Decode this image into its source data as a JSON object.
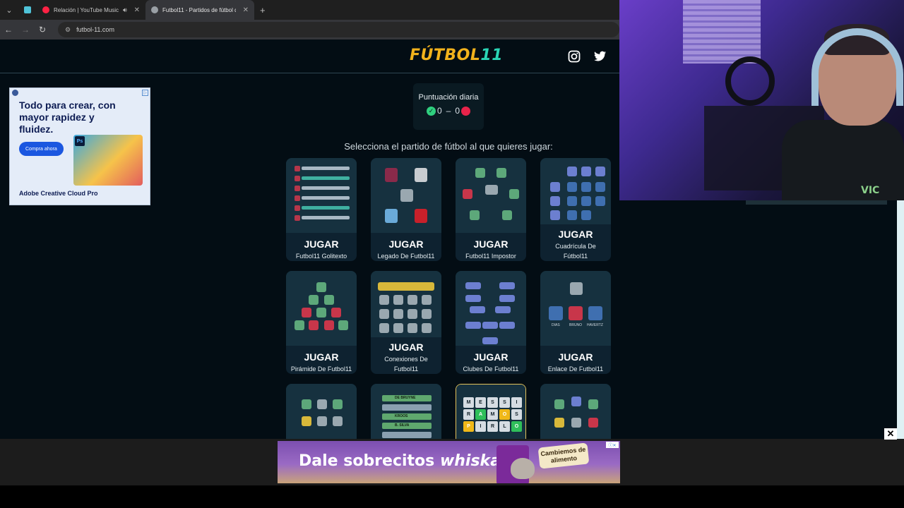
{
  "browser": {
    "tabs": [
      {
        "title": "Relación | YouTube Music",
        "favicon_color": "#ff2244"
      },
      {
        "title": "Futbol11 - Partidos de fútbol di",
        "favicon_color": "#9aa0a6"
      }
    ],
    "url": "futbol-11.com"
  },
  "site": {
    "logo_main": "FÚTBOL",
    "logo_num": "11",
    "daily_score": {
      "label": "Puntuación diaria",
      "wins": "0",
      "separator": "–",
      "losses": "0"
    },
    "prompt": "Selecciona el partido de fútbol al que quieres jugar:",
    "play_label": "JUGAR",
    "games": [
      {
        "name": "Futbol11 Golitexto"
      },
      {
        "name": "Legado De Futbol11"
      },
      {
        "name": "Futbol11 Impostor"
      },
      {
        "name": "Cuadrícula De Fútbol11"
      },
      {
        "name": "Pirámide De Futbol11"
      },
      {
        "name": "Conexiones De Futbol11"
      },
      {
        "name": "Clubes De Futbol11"
      },
      {
        "name": "Enlace De Futbol11"
      }
    ],
    "thumb_text": {
      "enlace_players": [
        "DIAS",
        "BRUNO",
        "HAVERTZ"
      ],
      "ranking": [
        "DE BRUYNE",
        "KROOS",
        "B. SILVA"
      ],
      "wordle_rows": [
        [
          "M",
          "E",
          "S",
          "S",
          "I"
        ],
        [
          "R",
          "A",
          "M",
          "O",
          "S"
        ],
        [
          "P",
          "I",
          "R",
          "L",
          "O"
        ]
      ]
    }
  },
  "side_ad": {
    "headline": "Todo para crear, con mayor rapidez y fluidez.",
    "button": "Compra ahora",
    "brand": "Adobe Creative Cloud Pro",
    "app_badge": "Ps"
  },
  "bottom_ad": {
    "text": "Dale sobrecitos",
    "brand": "whiskas",
    "bubble": "Cambiemos de alimento"
  },
  "webcam": {
    "shirt_text": "VIC"
  },
  "colors": {
    "logo_gold": "#f2b21c",
    "logo_teal": "#2ad4b4",
    "page_bg": "#030d14",
    "card_bg": "#0e2230",
    "win_green": "#2fcf7f",
    "loss_red": "#e8234a"
  }
}
